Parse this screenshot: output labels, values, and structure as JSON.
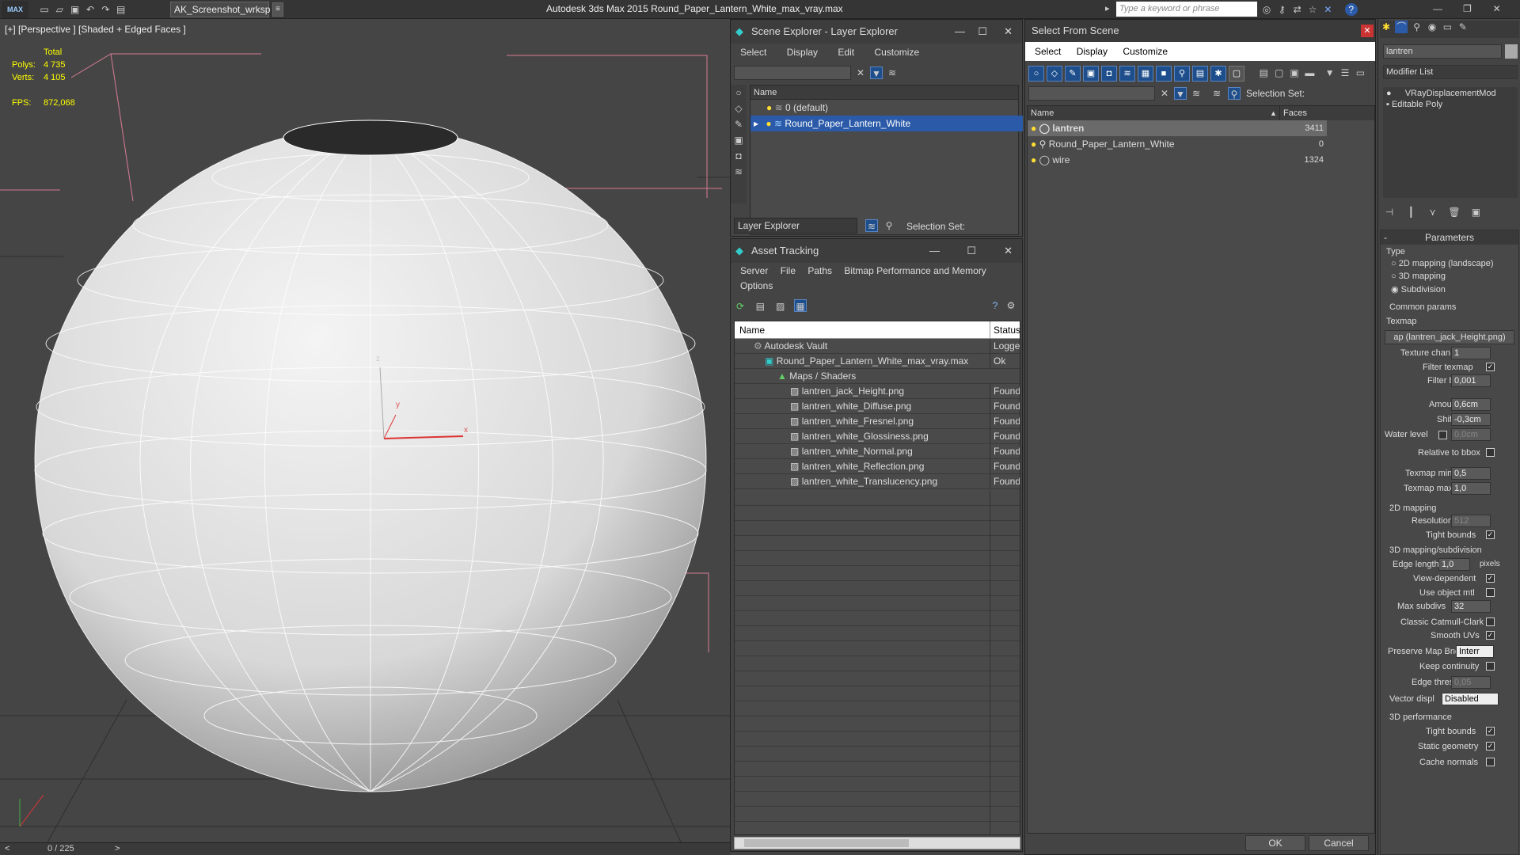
{
  "title_bar": {
    "logo": "MAX",
    "workspace": "AK_Screenshot_wrksp",
    "app_title": "Autodesk 3ds Max  2015    Round_Paper_Lantern_White_max_vray.max",
    "search_placeholder": "Type a keyword or phrase"
  },
  "viewport": {
    "label": "[+] [Perspective ] [Shaded + Edged Faces ]",
    "stats_total": "Total",
    "polys_label": "Polys:",
    "polys_value": "4 735",
    "verts_label": "Verts:",
    "verts_value": "4 105",
    "fps_label": "FPS:",
    "fps_value": "872,068",
    "axis_x": "x",
    "axis_y": "y",
    "axis_z": "z"
  },
  "status_bar": {
    "frame": "0 / 225",
    "prev": "<",
    "next": ">"
  },
  "scene_explorer": {
    "title": "Scene Explorer - Layer Explorer",
    "menu": [
      "Select",
      "Display",
      "Edit",
      "Customize"
    ],
    "column_name": "Name",
    "layers": [
      {
        "name": "0 (default)"
      },
      {
        "name": "Round_Paper_Lantern_White"
      }
    ],
    "footer_dropdown": "Layer Explorer",
    "selection_set_label": "Selection Set:"
  },
  "asset_tracking": {
    "title": "Asset Tracking",
    "menu": [
      "Server",
      "File",
      "Paths",
      "Bitmap Performance and Memory"
    ],
    "menu2": "Options",
    "col_name": "Name",
    "col_status": "Status",
    "rows": [
      {
        "name": "Autodesk Vault",
        "status": "Logged"
      },
      {
        "name": "Round_Paper_Lantern_White_max_vray.max",
        "status": "Ok"
      },
      {
        "name": "Maps / Shaders",
        "status": ""
      },
      {
        "name": "lantren_jack_Height.png",
        "status": "Found"
      },
      {
        "name": "lantren_white_Diffuse.png",
        "status": "Found"
      },
      {
        "name": "lantren_white_Fresnel.png",
        "status": "Found"
      },
      {
        "name": "lantren_white_Glossiness.png",
        "status": "Found"
      },
      {
        "name": "lantren_white_Normal.png",
        "status": "Found"
      },
      {
        "name": "lantren_white_Reflection.png",
        "status": "Found"
      },
      {
        "name": "lantren_white_Translucency.png",
        "status": "Found"
      }
    ]
  },
  "select_from_scene": {
    "title": "Select From Scene",
    "menu": [
      "Select",
      "Display",
      "Customize"
    ],
    "selection_set_label": "Selection Set:",
    "col_name": "Name",
    "col_faces": "Faces",
    "objects": [
      {
        "name": "lantren",
        "faces": "3411"
      },
      {
        "name": "Round_Paper_Lantern_White",
        "faces": "0"
      },
      {
        "name": "wire",
        "faces": "1324"
      }
    ],
    "ok_label": "OK",
    "cancel_label": "Cancel"
  },
  "command_panel": {
    "object_name": "lantren",
    "modifier_list": "Modifier List",
    "stack": [
      "VRayDisplacementMod",
      "Editable Poly"
    ],
    "rollout_title": "Parameters",
    "type_label": "Type",
    "type_options": [
      "2D mapping (landscape)",
      "3D mapping",
      "Subdivision"
    ],
    "common_params": "Common params",
    "texmap_label": "Texmap",
    "texmap_value": "ap (lantren_jack_Height.png)",
    "texture_chan_label": "Texture chan",
    "texture_chan_value": "1",
    "filter_texmap_label": "Filter texmap",
    "filter_blur_label": "Filter blur",
    "filter_blur_value": "0,001",
    "amount_label": "Amount",
    "amount_value": "0,6cm",
    "shift_label": "Shift",
    "shift_value": "-0,3cm",
    "water_level_label": "Water level",
    "water_level_value": "0,0cm",
    "relative_bbox_label": "Relative to bbox",
    "texmap_min_label": "Texmap min",
    "texmap_min_value": "0,5",
    "texmap_max_label": "Texmap max",
    "texmap_max_value": "1,0",
    "mapping2d_label": "2D mapping",
    "resolution_label": "Resolution",
    "resolution_value": "512",
    "tight_bounds_label": "Tight bounds",
    "mapping3d_label": "3D mapping/subdivision",
    "edge_length_label": "Edge length",
    "edge_length_value": "1,0",
    "pixels_label": "pixels",
    "view_dependent_label": "View-dependent",
    "use_object_mtl_label": "Use object mtl",
    "max_subdivs_label": "Max subdivs",
    "max_subdivs_value": "32",
    "classic_cc_label": "Classic Catmull-Clark",
    "smooth_uvs_label": "Smooth UVs",
    "preserve_map_label": "Preserve Map Bnd",
    "preserve_map_value": "Interr",
    "keep_continuity_label": "Keep continuity",
    "edge_thresh_label": "Edge thresh",
    "edge_thresh_value": "0,05",
    "vector_displ_label": "Vector displ",
    "vector_displ_value": "Disabled",
    "perf3d_label": "3D performance",
    "tight_bounds2_label": "Tight bounds",
    "static_geometry_label": "Static geometry",
    "cache_normals_label": "Cache normals"
  }
}
